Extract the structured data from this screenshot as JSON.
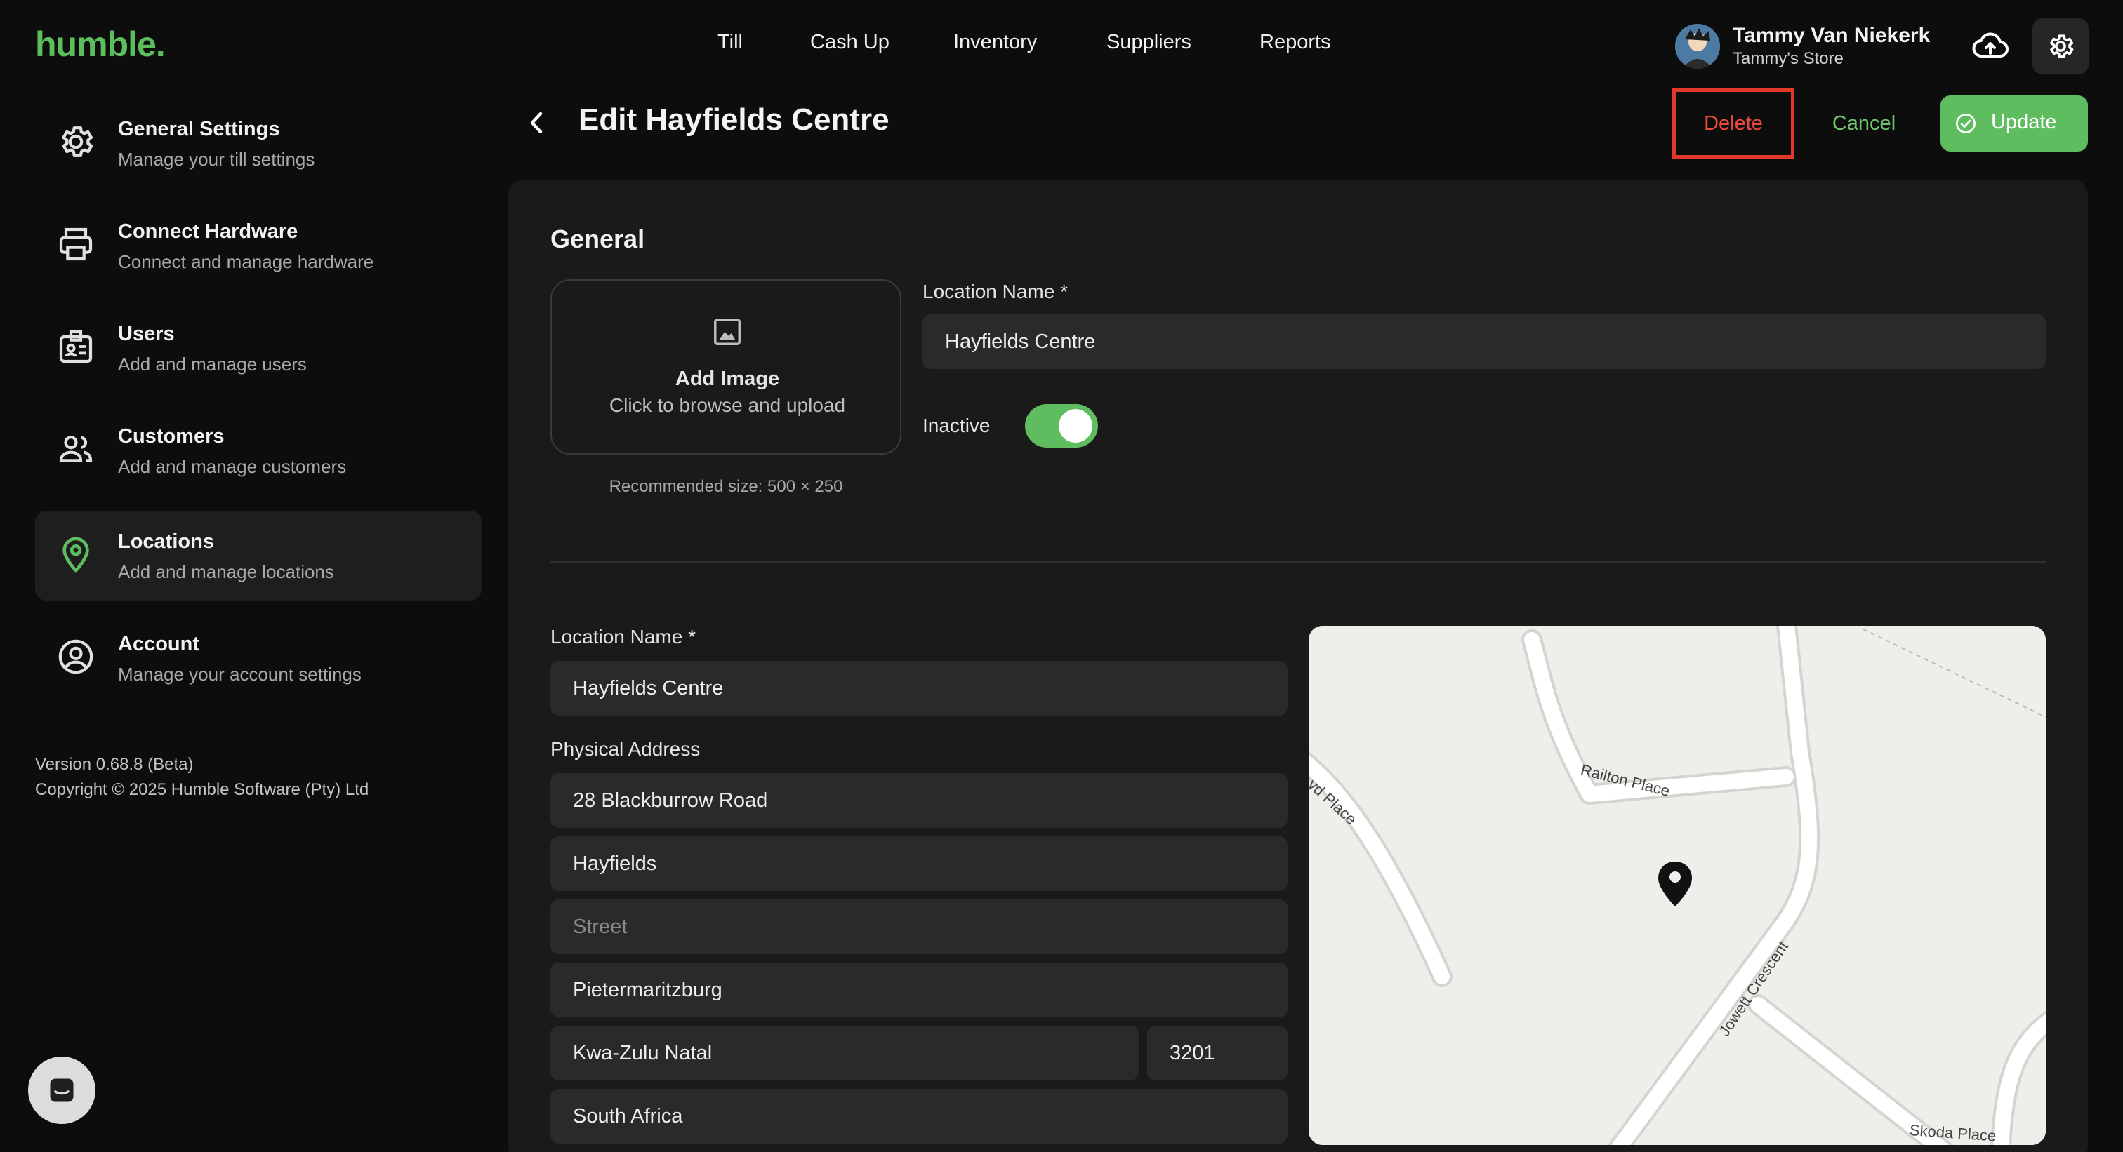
{
  "app": {
    "logo": "humble."
  },
  "nav": {
    "items": [
      "Till",
      "Cash Up",
      "Inventory",
      "Suppliers",
      "Reports"
    ]
  },
  "user": {
    "name": "Tammy Van Niekerk",
    "store": "Tammy's Store"
  },
  "sidebar": {
    "items": [
      {
        "title": "General Settings",
        "subtitle": "Manage your till settings",
        "icon": "gear-icon"
      },
      {
        "title": "Connect Hardware",
        "subtitle": "Connect and manage hardware",
        "icon": "printer-icon"
      },
      {
        "title": "Users",
        "subtitle": "Add and manage users",
        "icon": "id-badge-icon"
      },
      {
        "title": "Customers",
        "subtitle": "Add and manage customers",
        "icon": "people-icon"
      },
      {
        "title": "Locations",
        "subtitle": "Add and manage locations",
        "icon": "location-pin-icon",
        "active": true
      },
      {
        "title": "Account",
        "subtitle": "Manage your account settings",
        "icon": "user-circle-icon"
      }
    ],
    "version": "Version 0.68.8 (Beta)",
    "copyright": "Copyright © 2025 Humble Software (Pty) Ltd"
  },
  "header": {
    "title": "Edit Hayfields Centre",
    "delete_label": "Delete",
    "cancel_label": "Cancel",
    "update_label": "Update"
  },
  "general": {
    "section_title": "General",
    "image": {
      "title": "Add Image",
      "subtitle": "Click to browse and upload",
      "recommended": "Recommended size: 500 × 250"
    },
    "location_name_label": "Location Name *",
    "location_name_value": "Hayfields Centre",
    "inactive_label": "Inactive",
    "inactive_on": true
  },
  "address": {
    "location_name_label": "Location Name *",
    "location_name_value": "Hayfields Centre",
    "physical_address_label": "Physical Address",
    "line1": "28 Blackburrow Road",
    "suburb": "Hayfields",
    "street_placeholder": "Street",
    "city": "Pietermaritzburg",
    "province": "Kwa-Zulu Natal",
    "postal_code": "3201",
    "country": "South Africa"
  },
  "map": {
    "streets": [
      "Railton Place",
      "yd Place",
      "Jowett Crescent",
      "Skoda Place"
    ]
  },
  "colors": {
    "accent": "#5fbd5f",
    "danger": "#e03a2a",
    "background": "#0d0d0d",
    "card": "#1a1a1a"
  }
}
